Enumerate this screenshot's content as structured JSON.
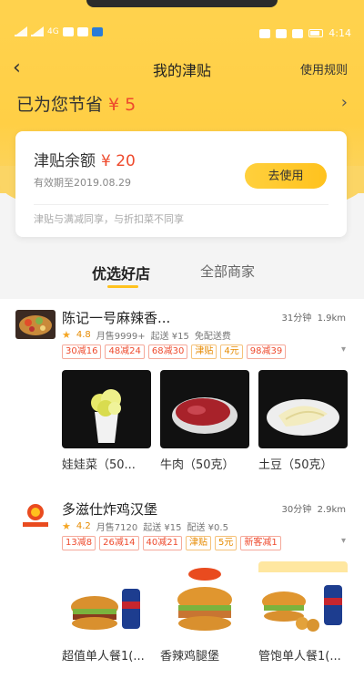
{
  "status": {
    "net": "4G",
    "time": "4:14"
  },
  "nav": {
    "title": "我的津贴",
    "rules": "使用规则"
  },
  "saved": {
    "label": "已为您节省",
    "amount": "¥ 5"
  },
  "card": {
    "balance_label": "津贴余额",
    "balance_amount": "¥ 20",
    "valid": "有效期至2019.08.29",
    "use_button": "去使用",
    "note": "津贴与满减同享，与折扣菜不同享"
  },
  "tabs": [
    {
      "label": "优选好店"
    },
    {
      "label": "全部商家"
    }
  ],
  "shops": [
    {
      "name": "陈记一号麻辣香...",
      "time": "31分钟",
      "distance": "1.9km",
      "rating": "4.8",
      "monthly": "月售9999+",
      "min_order": "起送 ¥15",
      "delivery": "免配送费",
      "tags": [
        "30减16",
        "48减24",
        "68减30",
        "津贴",
        "4元",
        "98减39"
      ],
      "dishes": [
        {
          "name": "娃娃菜（50..."
        },
        {
          "name": "牛肉（50克）"
        },
        {
          "name": "土豆（50克）"
        }
      ]
    },
    {
      "name": "多滋仕炸鸡汉堡",
      "time": "30分钟",
      "distance": "2.9km",
      "rating": "4.2",
      "monthly": "月售7120",
      "min_order": "起送 ¥15",
      "delivery": "配送 ¥0.5",
      "tags": [
        "13减8",
        "26减14",
        "40减21",
        "津贴",
        "5元",
        "新客减1"
      ],
      "dishes": [
        {
          "name": "超值单人餐1(..."
        },
        {
          "name": "香辣鸡腿堡"
        },
        {
          "name": "管饱单人餐1(..."
        }
      ]
    }
  ],
  "colors": {
    "brand": "#ffd24d",
    "accent": "#ee4a2d",
    "button": "#ffc21e"
  }
}
